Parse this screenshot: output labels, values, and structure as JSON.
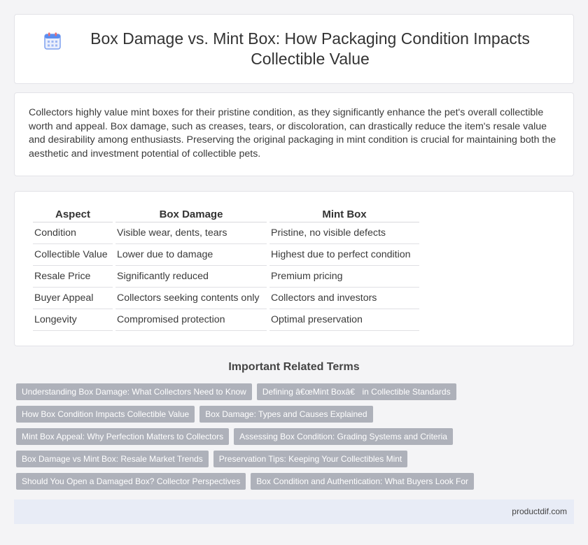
{
  "header": {
    "title": "Box Damage vs. Mint Box: How Packaging Condition Impacts Collectible Value",
    "icon": "calendar-icon"
  },
  "intro": {
    "text": "Collectors highly value mint boxes for their pristine condition, as they significantly enhance the pet's overall collectible worth and appeal. Box damage, such as creases, tears, or discoloration, can drastically reduce the item's resale value and desirability among enthusiasts. Preserving the original packaging in mint condition is crucial for maintaining both the aesthetic and investment potential of collectible pets."
  },
  "table": {
    "headers": [
      "Aspect",
      "Box Damage",
      "Mint Box"
    ],
    "rows": [
      [
        "Condition",
        "Visible wear, dents, tears",
        "Pristine, no visible defects"
      ],
      [
        "Collectible Value",
        "Lower due to damage",
        "Highest due to perfect condition"
      ],
      [
        "Resale Price",
        "Significantly reduced",
        "Premium pricing"
      ],
      [
        "Buyer Appeal",
        "Collectors seeking contents only",
        "Collectors and investors"
      ],
      [
        "Longevity",
        "Compromised protection",
        "Optimal preservation"
      ]
    ]
  },
  "related": {
    "title": "Important Related Terms",
    "rows": [
      [
        "Understanding Box Damage: What Collectors Need to Know",
        "Defining â€œMint Boxâ€ in Collectible Standards"
      ],
      [
        "How Box Condition Impacts Collectible Value",
        "Box Damage: Types and Causes Explained"
      ],
      [
        "Mint Box Appeal: Why Perfection Matters to Collectors",
        "Assessing Box Condition: Grading Systems and Criteria"
      ],
      [
        "Box Damage vs Mint Box: Resale Market Trends",
        "Preservation Tips: Keeping Your Collectibles Mint"
      ],
      [
        "Should You Open a Damaged Box? Collector Perspectives",
        "Box Condition and Authentication: What Buyers Look For"
      ]
    ]
  },
  "footer": {
    "site": "productdif.com"
  },
  "colors": {
    "tag_bg": "#aeb1ba",
    "footer_bg": "#e8ecf6",
    "icon_accent": "#5b8def"
  }
}
